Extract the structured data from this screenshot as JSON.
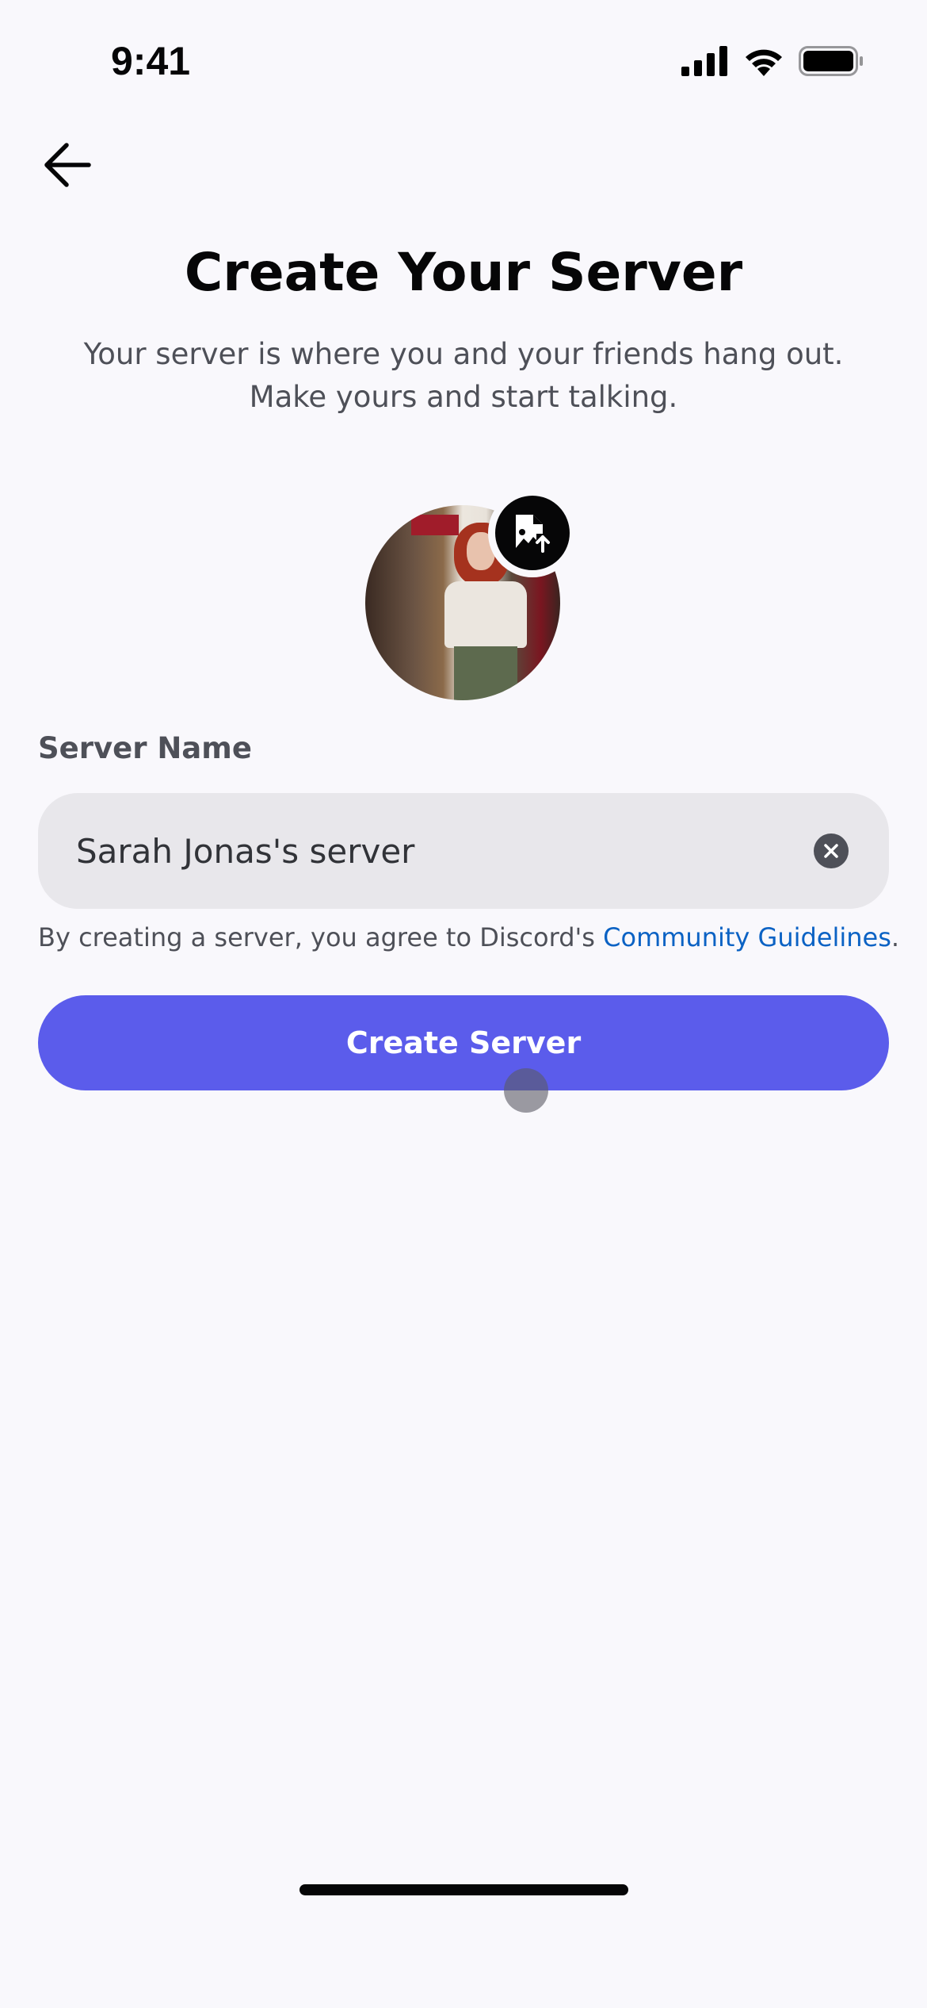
{
  "status_bar": {
    "time": "9:41",
    "icons": [
      "cellular-signal-icon",
      "wifi-icon",
      "battery-icon"
    ]
  },
  "header": {
    "back_icon": "arrow-left-icon"
  },
  "title": "Create Your Server",
  "subtitle_line1": "Your server is where you and your friends hang out.",
  "subtitle_line2": "Make yours and start talking.",
  "avatar": {
    "upload_icon": "image-upload-icon"
  },
  "form": {
    "label": "Server Name",
    "value": "Sarah Jonas's server",
    "clear_icon": "clear-x-icon"
  },
  "terms": {
    "prefix": "By creating a server, you agree to Discord's ",
    "link": "Community Guidelines",
    "suffix": "."
  },
  "create_button": "Create Server",
  "colors": {
    "accent": "#5b5ceb",
    "link": "#0b62c4",
    "background": "#f9f8fc"
  }
}
